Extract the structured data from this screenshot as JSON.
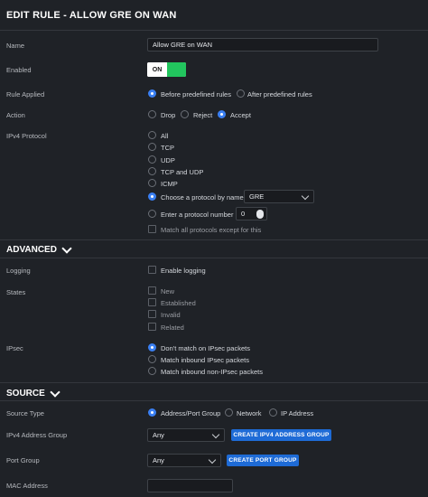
{
  "header": {
    "title": "EDIT RULE - ALLOW GRE ON WAN"
  },
  "general": {
    "name_label": "Name",
    "name_value": "Allow GRE on WAN",
    "enabled_label": "Enabled",
    "enabled_state": "ON",
    "rule_applied_label": "Rule Applied",
    "rule_applied_options": [
      "Before predefined rules",
      "After predefined rules"
    ],
    "action_label": "Action",
    "action_options": [
      "Drop",
      "Reject",
      "Accept"
    ],
    "ipv4_protocol_label": "IPv4 Protocol",
    "protocol_options": [
      "All",
      "TCP",
      "UDP",
      "TCP and UDP",
      "ICMP",
      "Choose a protocol by name",
      "Enter a protocol number"
    ],
    "protocol_by_name_value": "GRE",
    "protocol_number_value": "0",
    "match_all_except": "Match all protocols except for this"
  },
  "advanced": {
    "section_title": "ADVANCED",
    "logging_label": "Logging",
    "enable_logging": "Enable logging",
    "states_label": "States",
    "states_options": [
      "New",
      "Established",
      "Invalid",
      "Related"
    ],
    "ipsec_label": "IPsec",
    "ipsec_options": [
      "Don't match on IPsec packets",
      "Match inbound IPsec packets",
      "Match inbound non-IPsec packets"
    ]
  },
  "source": {
    "section_title": "SOURCE",
    "source_type_label": "Source Type",
    "source_type_options": [
      "Address/Port Group",
      "Network",
      "IP Address"
    ],
    "ipv4_group_label": "IPv4 Address Group",
    "ipv4_group_value": "Any",
    "create_ipv4_group": "CREATE IPV4 ADDRESS GROUP",
    "port_group_label": "Port Group",
    "port_group_value": "Any",
    "create_port_group": "CREATE PORT GROUP",
    "mac_address_label": "MAC Address",
    "mac_address_value": ""
  },
  "colors": {
    "accent": "#3a7ff2",
    "toggle_on": "#22c55e",
    "button": "#1e6bd6",
    "background": "#1f2227"
  }
}
